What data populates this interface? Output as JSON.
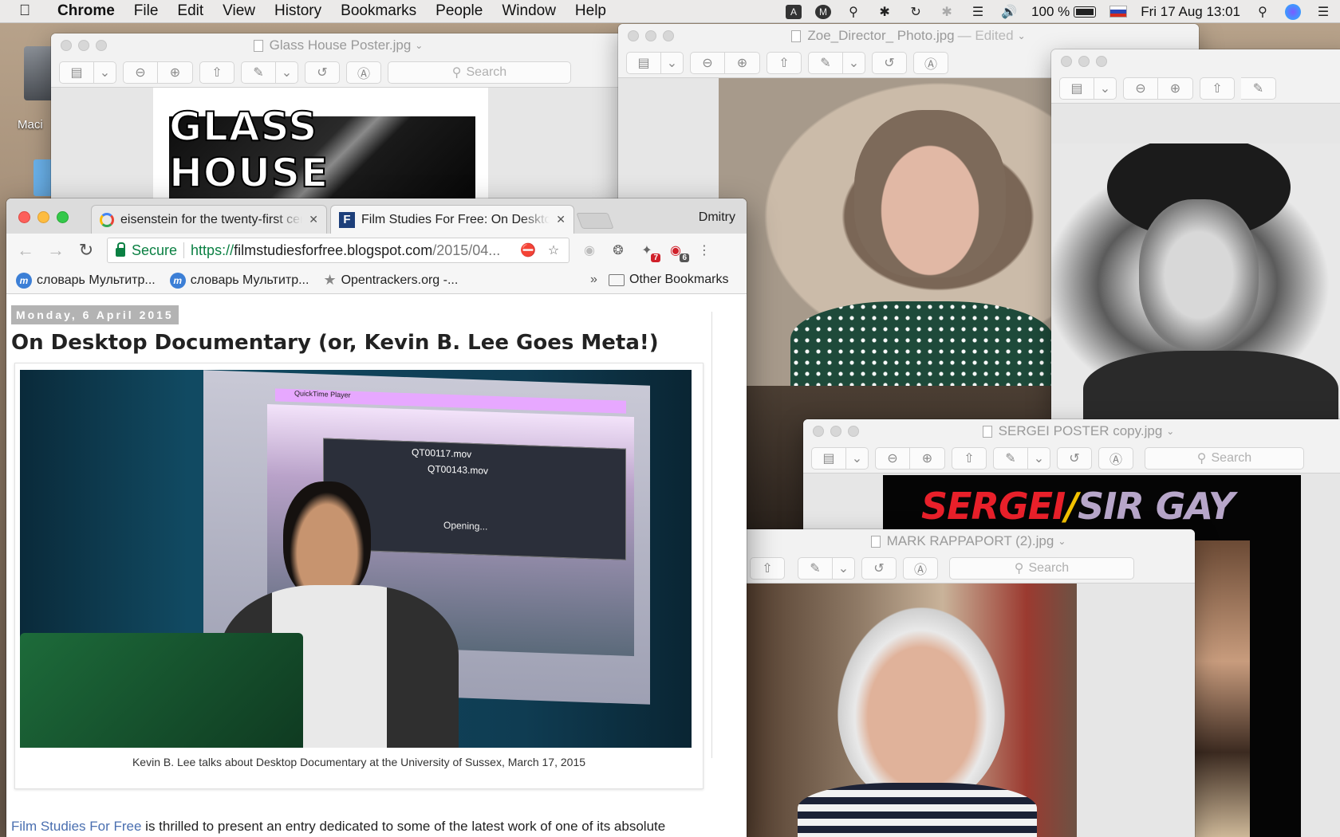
{
  "menubar": {
    "app": "Chrome",
    "items": [
      "File",
      "Edit",
      "View",
      "History",
      "Bookmarks",
      "People",
      "Window",
      "Help"
    ],
    "battery": "100 %",
    "clock": "Fri 17 Aug  13:01"
  },
  "desktop": {
    "hd_label": "Maci"
  },
  "preview_windows": {
    "glass_house": {
      "title": "Glass House Poster.jpg",
      "search_placeholder": "Search",
      "poster_text": "GLASS HOUSE"
    },
    "zoe": {
      "title": "Zoe_Director_ Photo.jpg",
      "edited": "— Edited"
    },
    "sergei_photo": {
      "title": ""
    },
    "sergei_poster": {
      "title": "SERGEI POSTER copy.jpg",
      "search_placeholder": "Search",
      "poster_word1": "SERGEI",
      "poster_slash": "/",
      "poster_word2": "SIR GAY"
    },
    "rappaport": {
      "title": "MARK RAPPAPORT (2).jpg",
      "search_placeholder": "Search"
    }
  },
  "chrome": {
    "tabs": [
      {
        "title": "eisenstein for the twenty-first century"
      },
      {
        "title": "Film Studies For Free: On Desktop Documentary"
      }
    ],
    "profile": "Dmitry",
    "omnibox": {
      "secure_label": "Secure",
      "url_scheme": "https://",
      "url_host": "filmstudiesforfree.blogspot.com",
      "url_path": "/2015/04..."
    },
    "bookmarks": [
      {
        "label": "словарь Мультитр..."
      },
      {
        "label": "словарь Мультитр..."
      },
      {
        "label": "Opentrackers.org -..."
      }
    ],
    "bookmarks_more": "»",
    "other_bookmarks": "Other Bookmarks",
    "ext_badges": {
      "ext1": "7",
      "ext2": "6"
    }
  },
  "blog": {
    "date": "Monday, 6 April 2015",
    "title": "On Desktop Documentary (or, Kevin B. Lee Goes Meta!)",
    "caption": "Kevin B. Lee talks about Desktop Documentary at the University of Sussex, March 17, 2015",
    "body_link": "Film Studies For Free",
    "body_rest": " is thrilled to present an entry dedicated to some of the latest work of one of its absolute",
    "screen_menu": "QuickTime Player",
    "screen_file1": "QT00117.mov",
    "screen_file2": "QT00143.mov",
    "screen_status": "Opening..."
  },
  "colors": {
    "secure_green": "#0b8043",
    "poster_red": "#e8202a",
    "poster_yellow": "#f2c100",
    "poster_purple": "#b7a6c9"
  }
}
